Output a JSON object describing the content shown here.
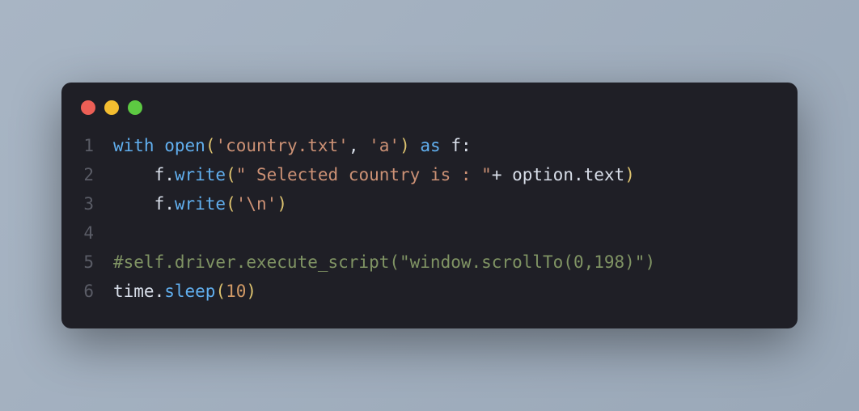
{
  "code": {
    "lines": [
      {
        "num": "1",
        "tokens": [
          {
            "cls": "tok-keyword",
            "text": "with"
          },
          {
            "cls": "tok-ident",
            "text": " "
          },
          {
            "cls": "tok-func",
            "text": "open"
          },
          {
            "cls": "tok-paren",
            "text": "("
          },
          {
            "cls": "tok-string",
            "text": "'country.txt'"
          },
          {
            "cls": "tok-punct",
            "text": ", "
          },
          {
            "cls": "tok-string",
            "text": "'a'"
          },
          {
            "cls": "tok-paren",
            "text": ")"
          },
          {
            "cls": "tok-ident",
            "text": " "
          },
          {
            "cls": "tok-keyword",
            "text": "as"
          },
          {
            "cls": "tok-ident",
            "text": " f:"
          }
        ]
      },
      {
        "num": "2",
        "tokens": [
          {
            "cls": "tok-ident",
            "text": "    f."
          },
          {
            "cls": "tok-func",
            "text": "write"
          },
          {
            "cls": "tok-paren",
            "text": "("
          },
          {
            "cls": "tok-string",
            "text": "\" Selected country is : \""
          },
          {
            "cls": "tok-punct",
            "text": "+ option.text"
          },
          {
            "cls": "tok-paren",
            "text": ")"
          }
        ]
      },
      {
        "num": "3",
        "tokens": [
          {
            "cls": "tok-ident",
            "text": "    f."
          },
          {
            "cls": "tok-func",
            "text": "write"
          },
          {
            "cls": "tok-paren",
            "text": "("
          },
          {
            "cls": "tok-string",
            "text": "'\\n'"
          },
          {
            "cls": "tok-paren",
            "text": ")"
          }
        ]
      },
      {
        "num": "4",
        "tokens": []
      },
      {
        "num": "5",
        "tokens": [
          {
            "cls": "tok-comment",
            "text": "#self.driver.execute_script(\"window.scrollTo(0,198)\")"
          }
        ]
      },
      {
        "num": "6",
        "tokens": [
          {
            "cls": "tok-ident",
            "text": "time."
          },
          {
            "cls": "tok-func",
            "text": "sleep"
          },
          {
            "cls": "tok-paren",
            "text": "("
          },
          {
            "cls": "tok-number",
            "text": "10"
          },
          {
            "cls": "tok-paren",
            "text": ")"
          }
        ]
      }
    ]
  }
}
